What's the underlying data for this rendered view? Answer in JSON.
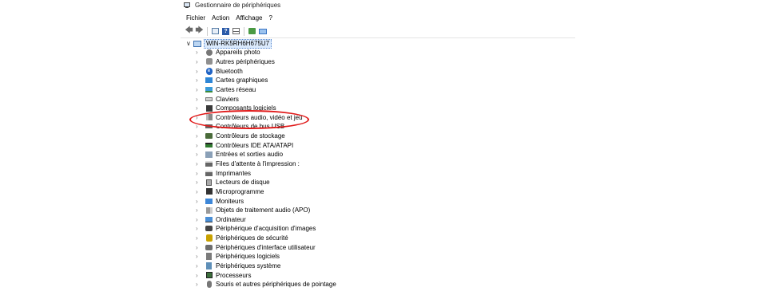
{
  "window": {
    "title": "Gestionnaire de périphériques"
  },
  "menu": [
    "Fichier",
    "Action",
    "Affichage",
    "?"
  ],
  "toolbar": {
    "buttons": [
      "back-arrow-icon",
      "forward-arrow-icon",
      "properties-icon",
      "help-icon",
      "view-icon",
      "update-driver-icon",
      "scan-hardware-icon"
    ]
  },
  "tree": {
    "root": {
      "label": "WIN-RK5RH6H675U7",
      "expanded": true
    },
    "items": [
      {
        "label": "Appareils photo",
        "icon": "camera-icon"
      },
      {
        "label": "Autres périphériques",
        "icon": "other-devices-icon"
      },
      {
        "label": "Bluetooth",
        "icon": "bluetooth-icon"
      },
      {
        "label": "Cartes graphiques",
        "icon": "display-adapter-icon"
      },
      {
        "label": "Cartes réseau",
        "icon": "network-adapter-icon"
      },
      {
        "label": "Claviers",
        "icon": "keyboard-icon"
      },
      {
        "label": "Composants logiciels",
        "icon": "software-component-icon"
      },
      {
        "label": "Contrôleurs audio, vidéo et jeu",
        "icon": "audio-controller-icon",
        "highlighted": true
      },
      {
        "label": "Contrôleurs de bus USB",
        "icon": "usb-controller-icon"
      },
      {
        "label": "Contrôleurs de stockage",
        "icon": "storage-controller-icon"
      },
      {
        "label": "Contrôleurs IDE ATA/ATAPI",
        "icon": "ide-controller-icon"
      },
      {
        "label": "Entrées et sorties audio",
        "icon": "audio-io-icon"
      },
      {
        "label": "Files d'attente à l'impression :",
        "icon": "print-queue-icon"
      },
      {
        "label": "Imprimantes",
        "icon": "printer-icon"
      },
      {
        "label": "Lecteurs de disque",
        "icon": "disk-drive-icon"
      },
      {
        "label": "Microprogramme",
        "icon": "firmware-icon"
      },
      {
        "label": "Moniteurs",
        "icon": "monitor-icon"
      },
      {
        "label": "Objets de traitement audio (APO)",
        "icon": "apo-icon"
      },
      {
        "label": "Ordinateur",
        "icon": "computer-icon"
      },
      {
        "label": "Périphérique d'acquisition d'images",
        "icon": "imaging-device-icon"
      },
      {
        "label": "Périphériques de sécurité",
        "icon": "security-device-icon"
      },
      {
        "label": "Périphériques d'interface utilisateur",
        "icon": "hid-icon"
      },
      {
        "label": "Périphériques logiciels",
        "icon": "software-device-icon"
      },
      {
        "label": "Périphériques système",
        "icon": "system-device-icon"
      },
      {
        "label": "Processeurs",
        "icon": "processor-icon"
      },
      {
        "label": "Souris et autres périphériques de pointage",
        "icon": "mouse-icon"
      }
    ]
  },
  "annotation": {
    "color": "#e01919",
    "target": "Contrôleurs audio, vidéo et jeu"
  }
}
